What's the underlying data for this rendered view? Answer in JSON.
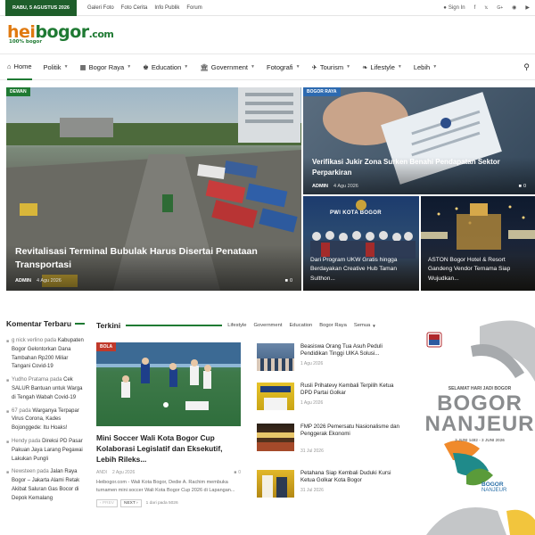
{
  "topbar": {
    "date": "RABU, 5 AGUSTUS 2026",
    "links": [
      "Galeri Foto",
      "Foto Cerita",
      "Info Publik",
      "Forum"
    ],
    "signin": "Sign In"
  },
  "logo": {
    "hei": "hei",
    "bogor": "bogor",
    "com": ".com",
    "tagline": "100% bogor"
  },
  "nav": {
    "items": [
      {
        "label": "Home",
        "icon": "home-icon"
      },
      {
        "label": "Politik",
        "icon": ""
      },
      {
        "label": "Bogor Raya",
        "icon": "map-icon"
      },
      {
        "label": "Education",
        "icon": "education-icon"
      },
      {
        "label": "Government",
        "icon": "bank-icon"
      },
      {
        "label": "Fotografi",
        "icon": ""
      },
      {
        "label": "Tourism",
        "icon": "plane-icon"
      },
      {
        "label": "Lifestyle",
        "icon": "leaf-icon"
      },
      {
        "label": "Lebih",
        "icon": ""
      }
    ]
  },
  "hero": {
    "main": {
      "badge": "DEWAN",
      "title": "Revitalisasi Terminal Bubulak Harus Disertai Penataan Transportasi",
      "author": "ADMIN",
      "date": "4 Agu 2026",
      "comments": "0"
    },
    "top_right": {
      "badge": "BOGOR RAYA",
      "title": "Verifikasi Jukir Zona Surken Benahi Pendapatan Sektor Perparkiran",
      "author": "ADMIN",
      "date": "4 Agu 2026",
      "comments": "0"
    },
    "bottom_a": {
      "title": "Dari Program UKW Gratis hingga Berdayakan Creative Hub Taman Sulthon...",
      "sign": "PWI KOTA BOGOR"
    },
    "bottom_b": {
      "title": "ASTON Bogor Hotel & Resort Gandeng Vendor Ternama Siap Wujudkan..."
    }
  },
  "left": {
    "title": "Komentar Terbaru",
    "comments": [
      {
        "user": "g nick verlino",
        "pada": "pada",
        "article": "Kabupaten Bogor Gelontorkan Dana Tambahan Rp200 Miliar Tangani Covid-19"
      },
      {
        "user": "Yudho Pratama",
        "pada": "pada",
        "article": "Cek SALUR Bantuan untuk Warga di Tengah Wabah Covid-19"
      },
      {
        "user": "67",
        "pada": "pada",
        "article": "Warganya Terpapar Virus Corona, Kades Bojonggede: Itu Hoaks!"
      },
      {
        "user": "Hendy",
        "pada": "pada",
        "article": "Direksi PD Pasar Pakuan Jaya Larang Pegawai Lakukan Pungli"
      },
      {
        "user": "Newsteen",
        "pada": "pada",
        "article": "Jalan Raya Bogor – Jakarta Alami Retak Akibat Saluran Gas Bocor di Depok Kemalang"
      }
    ]
  },
  "mid": {
    "title": "Terkini",
    "tabs": [
      "Lifestyle",
      "Government",
      "Education",
      "Bogor Raya",
      "Semua"
    ],
    "feature": {
      "badge": "BOLA",
      "title": "Mini Soccer Wali Kota Bogor Cup Kolaborasi Legislatif dan Eksekutif, Lebih Rileks...",
      "author": "ANDI",
      "date": "2 Agu 2026",
      "comments": "0",
      "excerpt": "Heibogor.com - Wali Kota Bogor, Dedie A. Rachim membuka turnamen mini soccer Wali Kota Bogor Cup 2026 di Lapangan..."
    },
    "pager": {
      "prev": "‹ PREV",
      "next": "NEXT ›",
      "info": "1 dari pada 5026"
    },
    "items": [
      {
        "title": "Beasiswa Orang Tua Asuh Peduli Pendidikan Tinggi UIKA Solusi...",
        "date": "1 Agu 2026"
      },
      {
        "title": "Rusli Prihatevy Kembali Terpilih Ketua DPD Partai Golkar",
        "date": "1 Agu 2026"
      },
      {
        "title": "FMP 2026 Pemersatu Nasionalisme dan Penggerak Ekonomi",
        "date": "31 Jul 2026"
      },
      {
        "title": "Petahana Siap Kembali Duduki Kursi Ketua Golkar Kota Bogor",
        "date": "31 Jul 2026"
      }
    ]
  },
  "ad": {
    "greeting": "SELAMAT HARI JADI BOGOR",
    "line1": "BOGOR",
    "line2": "NANJEUR",
    "dates": "3 JUNI 1482 - 3 JUNI 2026",
    "small1": "BOGOR",
    "small2": "NANJEUR"
  }
}
